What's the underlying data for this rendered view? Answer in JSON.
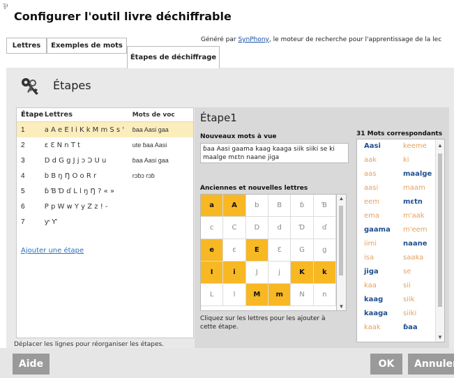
{
  "window": {
    "title": "Configurer l'outil livre déchiffrable",
    "corner_icon": "app-icon"
  },
  "tabs": [
    {
      "label": "Lettres"
    },
    {
      "label": "Exemples de mots"
    },
    {
      "label": "Étapes de déchiffrage",
      "active": true
    }
  ],
  "generated": {
    "prefix": "Généré par ",
    "link": "SynPhony",
    "suffix": ", le moteur de recherche pour l'apprentissage de la lec"
  },
  "section": {
    "title": "Étapes",
    "icon": "keys-icon"
  },
  "steps_table": {
    "columns": [
      "Étape",
      "Lettres",
      "Mots de voc"
    ],
    "rows": [
      {
        "num": "1",
        "letters": "a A e E I i K k M m S s ꞌ",
        "words": "ɓaa Aasi gaa",
        "selected": true
      },
      {
        "num": "2",
        "letters": "ɛ Ɛ N n T t",
        "words": "ute ɓaa Aasi"
      },
      {
        "num": "3",
        "letters": "D d G g J j ɔ Ɔ U u",
        "words": "ɓaa Aasi gaa"
      },
      {
        "num": "4",
        "letters": "b B ŋ Ŋ O o R r",
        "words": "rɔɓɔ rɔɓ"
      },
      {
        "num": "5",
        "letters": "ɓ Ɓ Ɗ ɗ L l ŋ Ŋ ? « »",
        "words": ""
      },
      {
        "num": "6",
        "letters": "P p W w Y y Z z ! -",
        "words": ""
      },
      {
        "num": "7",
        "letters": "ƴ Ƴ",
        "words": ""
      }
    ],
    "add_link": "Ajouter une étape"
  },
  "hint": "Déplacer les lignes pour réorganiser les étapes.",
  "detail": {
    "title": "Étape1",
    "new_words_label": "Nouveaux mots à vue",
    "new_words_text": "ɓaa Aasi gaama kaag kaaga siik siiki se ki maalge mɛtn naane jiga",
    "letters_label": "Anciennes et nouvelles lettres",
    "grid": [
      {
        "t": "a",
        "on": true
      },
      {
        "t": "A",
        "on": true
      },
      {
        "t": "b",
        "on": false
      },
      {
        "t": "B",
        "on": false
      },
      {
        "t": "ɓ",
        "on": false
      },
      {
        "t": "Ɓ",
        "on": false
      },
      {
        "t": "c",
        "on": false
      },
      {
        "t": "C",
        "on": false
      },
      {
        "t": "D",
        "on": false
      },
      {
        "t": "d",
        "on": false
      },
      {
        "t": "Ɗ",
        "on": false
      },
      {
        "t": "ɗ",
        "on": false
      },
      {
        "t": "e",
        "on": true
      },
      {
        "t": "ɛ",
        "on": false
      },
      {
        "t": "E",
        "on": true
      },
      {
        "t": "Ɛ",
        "on": false
      },
      {
        "t": "G",
        "on": false
      },
      {
        "t": "g",
        "on": false
      },
      {
        "t": "I",
        "on": true
      },
      {
        "t": "i",
        "on": true
      },
      {
        "t": "J",
        "on": false
      },
      {
        "t": "j",
        "on": false
      },
      {
        "t": "K",
        "on": true
      },
      {
        "t": "k",
        "on": true
      },
      {
        "t": "L",
        "on": false
      },
      {
        "t": "l",
        "on": false
      },
      {
        "t": "M",
        "on": true
      },
      {
        "t": "m",
        "on": true
      },
      {
        "t": "N",
        "on": false
      },
      {
        "t": "n",
        "on": false
      }
    ],
    "grid_hint": "Cliquez sur les lettres pour les ajouter à cette étape.",
    "words_label": "31 Mots correspondants",
    "words": [
      {
        "t": "Aasi",
        "new": true
      },
      {
        "t": "keeme",
        "new": false
      },
      {
        "t": "aak",
        "new": false
      },
      {
        "t": "ki",
        "new": false
      },
      {
        "t": "aas",
        "new": false
      },
      {
        "t": "maalge",
        "new": true
      },
      {
        "t": "aasi",
        "new": false
      },
      {
        "t": "maam",
        "new": false
      },
      {
        "t": "eem",
        "new": false
      },
      {
        "t": "mɛtn",
        "new": true
      },
      {
        "t": "ema",
        "new": false
      },
      {
        "t": "m'aak",
        "new": false
      },
      {
        "t": "gaama",
        "new": true
      },
      {
        "t": "m'eem",
        "new": false
      },
      {
        "t": "iimi",
        "new": false
      },
      {
        "t": "naane",
        "new": true
      },
      {
        "t": "isa",
        "new": false
      },
      {
        "t": "saaka",
        "new": false
      },
      {
        "t": "jiga",
        "new": true
      },
      {
        "t": "se",
        "new": false
      },
      {
        "t": "kaa",
        "new": false
      },
      {
        "t": "sii",
        "new": false
      },
      {
        "t": "kaag",
        "new": true
      },
      {
        "t": "siik",
        "new": false
      },
      {
        "t": "kaaga",
        "new": true
      },
      {
        "t": "siiki",
        "new": false
      },
      {
        "t": "kaak",
        "new": false
      },
      {
        "t": "ɓaa",
        "new": true
      }
    ],
    "colors": {
      "highlight": "#f7b824",
      "selected_row": "#fbeebc",
      "new_word": "#1f4f8f",
      "old_word": "#e6a05c"
    }
  },
  "buttons": {
    "help": "Aide",
    "ok": "OK",
    "cancel": "Annuler"
  }
}
